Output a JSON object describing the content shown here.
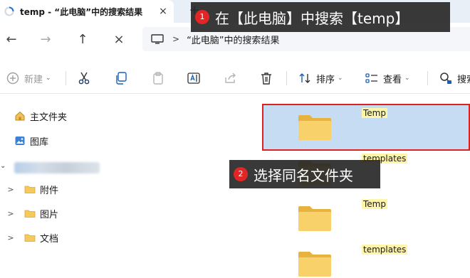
{
  "tab": {
    "title": "temp - “此电脑”中的搜索结果",
    "close": "×",
    "new_tab": "+"
  },
  "nav": {
    "back": "←",
    "forward": "→",
    "up": "↑",
    "close": "×"
  },
  "address": {
    "separator": ">",
    "text": "“此电脑”中的搜索结果"
  },
  "toolbar": {
    "new_label": "新建",
    "sort_label": "排序",
    "view_label": "查看",
    "search_label": "搜索",
    "caret": "⌄"
  },
  "sidebar": {
    "chevron": ">",
    "collapse_chevron": "⌄",
    "home": "主文件夹",
    "gallery": "图库",
    "items": [
      {
        "label": "附件"
      },
      {
        "label": "图片"
      },
      {
        "label": "文档"
      }
    ]
  },
  "files": [
    {
      "name": "Temp"
    },
    {
      "name": "templates"
    },
    {
      "name": "Temp"
    },
    {
      "name": "templates"
    }
  ],
  "annotations": [
    {
      "number": "1",
      "text": "在【此电脑】中搜索【temp】"
    },
    {
      "number": "2",
      "text": "选择同名文件夹"
    }
  ],
  "colors": {
    "accent_red": "#e02020",
    "selection": "#c6dcf2",
    "highlight": "#fff5a6",
    "folder": "#f6c95c"
  }
}
